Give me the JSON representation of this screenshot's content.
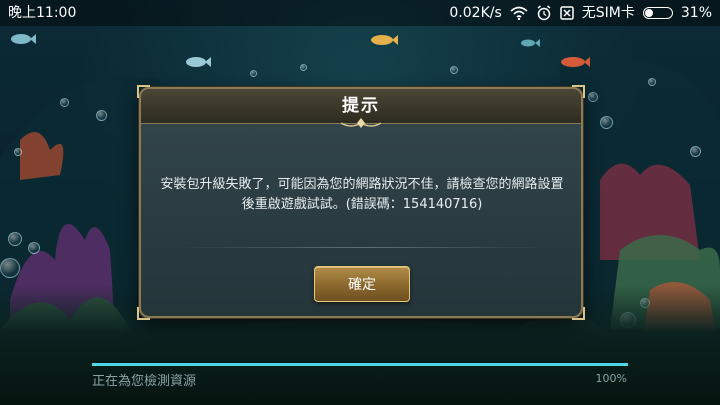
{
  "status_bar": {
    "time": "晚上11:00",
    "network_speed": "0.02K/s",
    "sim_status": "无SIM卡",
    "battery_percent": "31%",
    "battery_level": 0.31,
    "icons": [
      "wifi-icon",
      "alarm-icon",
      "no-sim-icon",
      "battery-icon"
    ]
  },
  "dialog": {
    "title": "提示",
    "message": "安裝包升級失敗了，可能因為您的網路狀況不佳，請檢查您的網路設置後重啟遊戲試試。(錯誤碼：154140716)",
    "confirm_label": "確定"
  },
  "loading": {
    "label": "正在為您檢測資源",
    "percent_text": "100%",
    "progress": 1.0
  },
  "colors": {
    "accent_gold": "#b38d49",
    "progress_fill": "#4fd6e6",
    "dialog_border": "#8a7a55"
  }
}
